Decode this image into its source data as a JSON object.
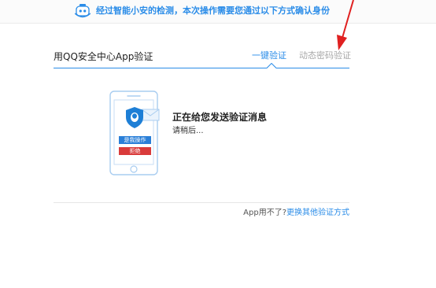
{
  "notice": {
    "text": "经过智能小安的检测，本次操作需要您通过以下方式确认身份",
    "icon": "robot-icon"
  },
  "header": {
    "title": "用QQ安全中心App验证",
    "tabs": [
      {
        "label": "一键验证",
        "active": true
      },
      {
        "label": "动态密码验证",
        "active": false
      }
    ]
  },
  "phone": {
    "confirm_label": "是我操作",
    "reject_label": "拒绝",
    "icon": "qq-shield-icon"
  },
  "status": {
    "title": "正在给您发送验证消息",
    "subtitle": "请稍后..."
  },
  "footer": {
    "question": "App用不了?",
    "link": "更换其他验证方式"
  },
  "colors": {
    "accent": "#2a8ce8",
    "reject": "#d93b3b",
    "arrow": "#e02020"
  }
}
